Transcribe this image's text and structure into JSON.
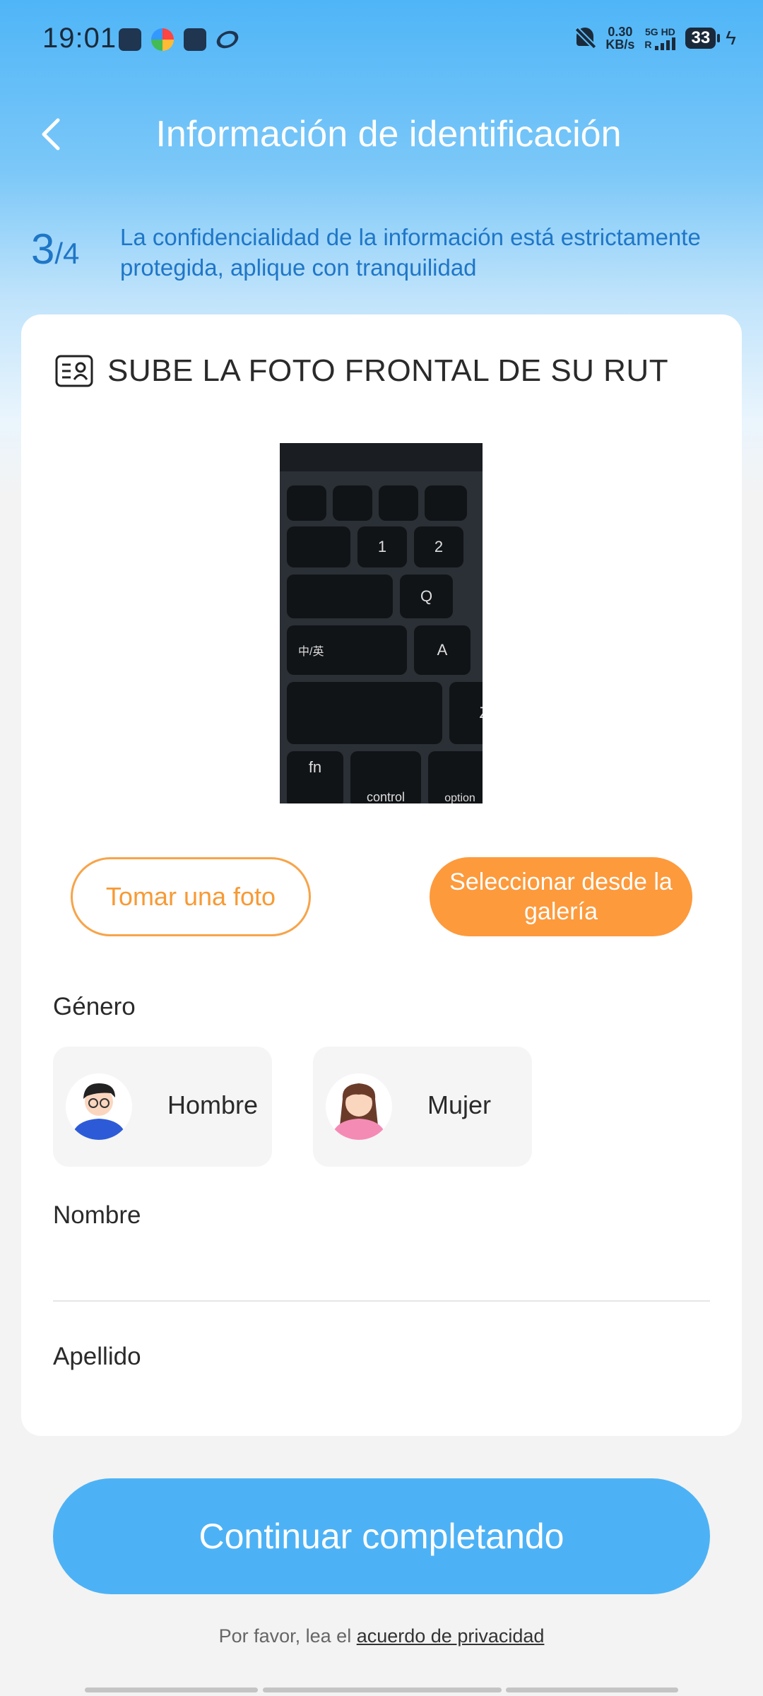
{
  "status_bar": {
    "time": "19:01",
    "net_speed": "0.30",
    "net_unit": "KB/s",
    "network": "5G HD",
    "roaming": "R",
    "battery": "33",
    "colors": {
      "icon": "#1b2a3a"
    }
  },
  "header": {
    "title": "Información de identificación",
    "back_icon": "chevron-left-icon"
  },
  "step": {
    "current": "3",
    "total": "/4",
    "note": "La confidencialidad de la información está estrictamente protegida, aplique con tranquilidad"
  },
  "card": {
    "title": "SUBE LA FOTO FRONTAL DE SU RUT",
    "title_icon": "id-card-icon",
    "photo": {
      "keys": [
        "1",
        "2",
        "Q",
        "A",
        "中/英",
        "fn",
        "control",
        "option",
        "Z"
      ]
    },
    "buttons": {
      "take_photo": "Tomar una foto",
      "gallery": "Seleccionar desde la galería"
    },
    "gender": {
      "label": "Género",
      "options": [
        "Hombre",
        "Mujer"
      ]
    },
    "first_name": {
      "label": "Nombre",
      "value": ""
    },
    "last_name": {
      "label": "Apellido",
      "value": ""
    }
  },
  "footer": {
    "continue_label": "Continuar completando",
    "privacy_prefix": "Por favor, lea el",
    "privacy_link": "acuerdo de privacidad"
  },
  "colors": {
    "primary": "#4db2f5",
    "accent": "#fd9a3c",
    "step_text": "#1f76c7"
  }
}
